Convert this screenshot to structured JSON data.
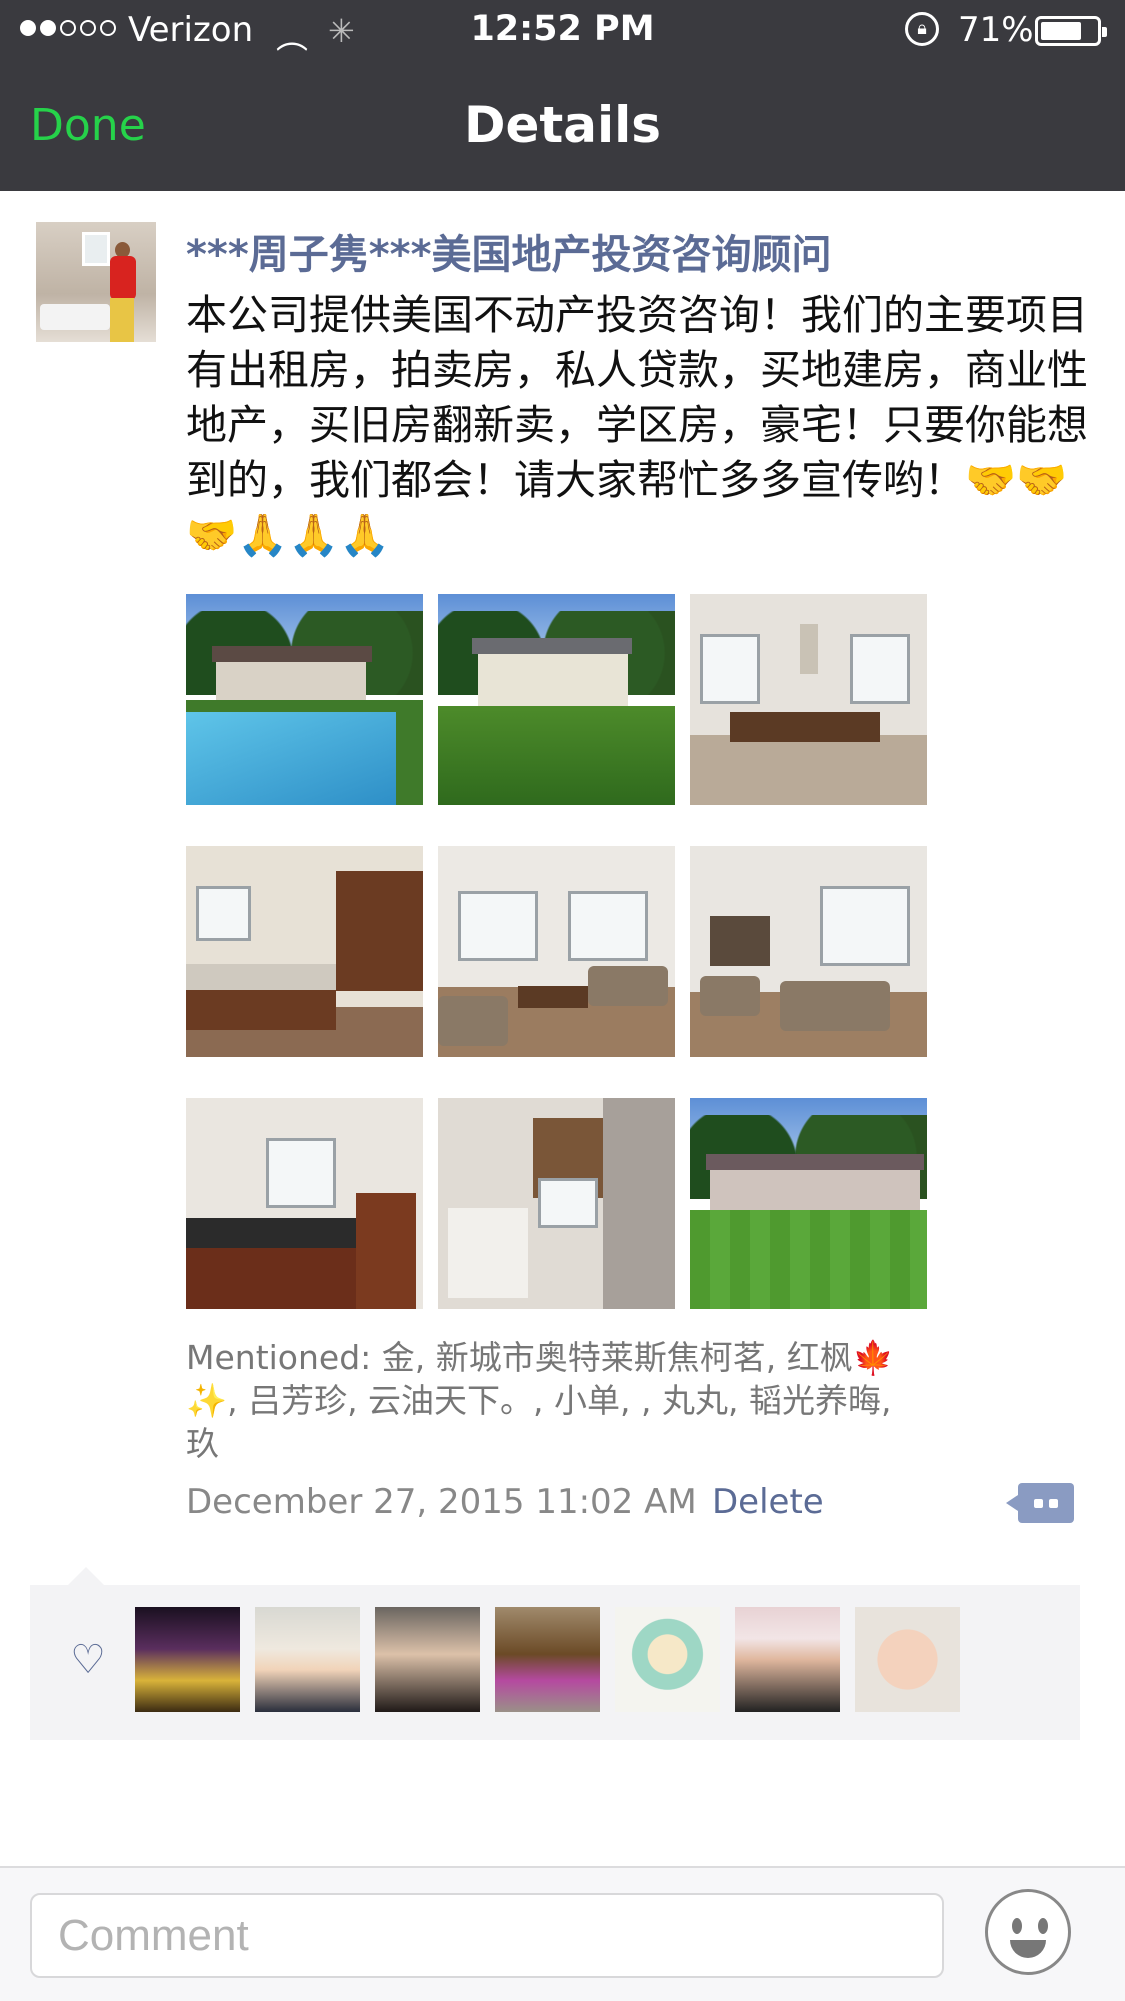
{
  "status_bar": {
    "carrier": "Verizon",
    "time": "12:52 PM",
    "battery_percent": "71%",
    "battery_level": 0.71,
    "signal_bars": 2,
    "icons": [
      "signal-dots-icon",
      "wifi-icon",
      "activity-spinner-icon",
      "rotation-lock-icon",
      "battery-icon"
    ]
  },
  "nav": {
    "done_label": "Done",
    "title": "Details"
  },
  "post": {
    "author": "***周子隽***美国地产投资咨询顾问",
    "text": "本公司提供美国不动产投资咨询！我们的主要项目有出租房，拍卖房，私人贷款，买地建房，商业性地产，买旧房翻新卖，学区房，豪宅！只要你能想到的，我们都会！请大家帮忙多多宣传哟！🤝🤝🤝🙏🙏🙏",
    "photo_count": 9,
    "mentioned": "Mentioned: 金, 新城市奥特莱斯焦柯茗, 红枫🍁✨, 吕芳珍, 云油天下。, 小单, , 丸丸, 韬光养晦, 玖",
    "timestamp": "December 27, 2015 11:02 AM",
    "delete_label": "Delete"
  },
  "likes": {
    "icon": "heart-icon",
    "count": 7
  },
  "comment_bar": {
    "placeholder": "Comment",
    "emoji_icon": "emoji-face-icon"
  },
  "colors": {
    "nav_bg": "#3a3a3f",
    "done_green": "#26d24a",
    "link_blue": "#5b6b95",
    "likes_bg": "#f3f3f5"
  }
}
